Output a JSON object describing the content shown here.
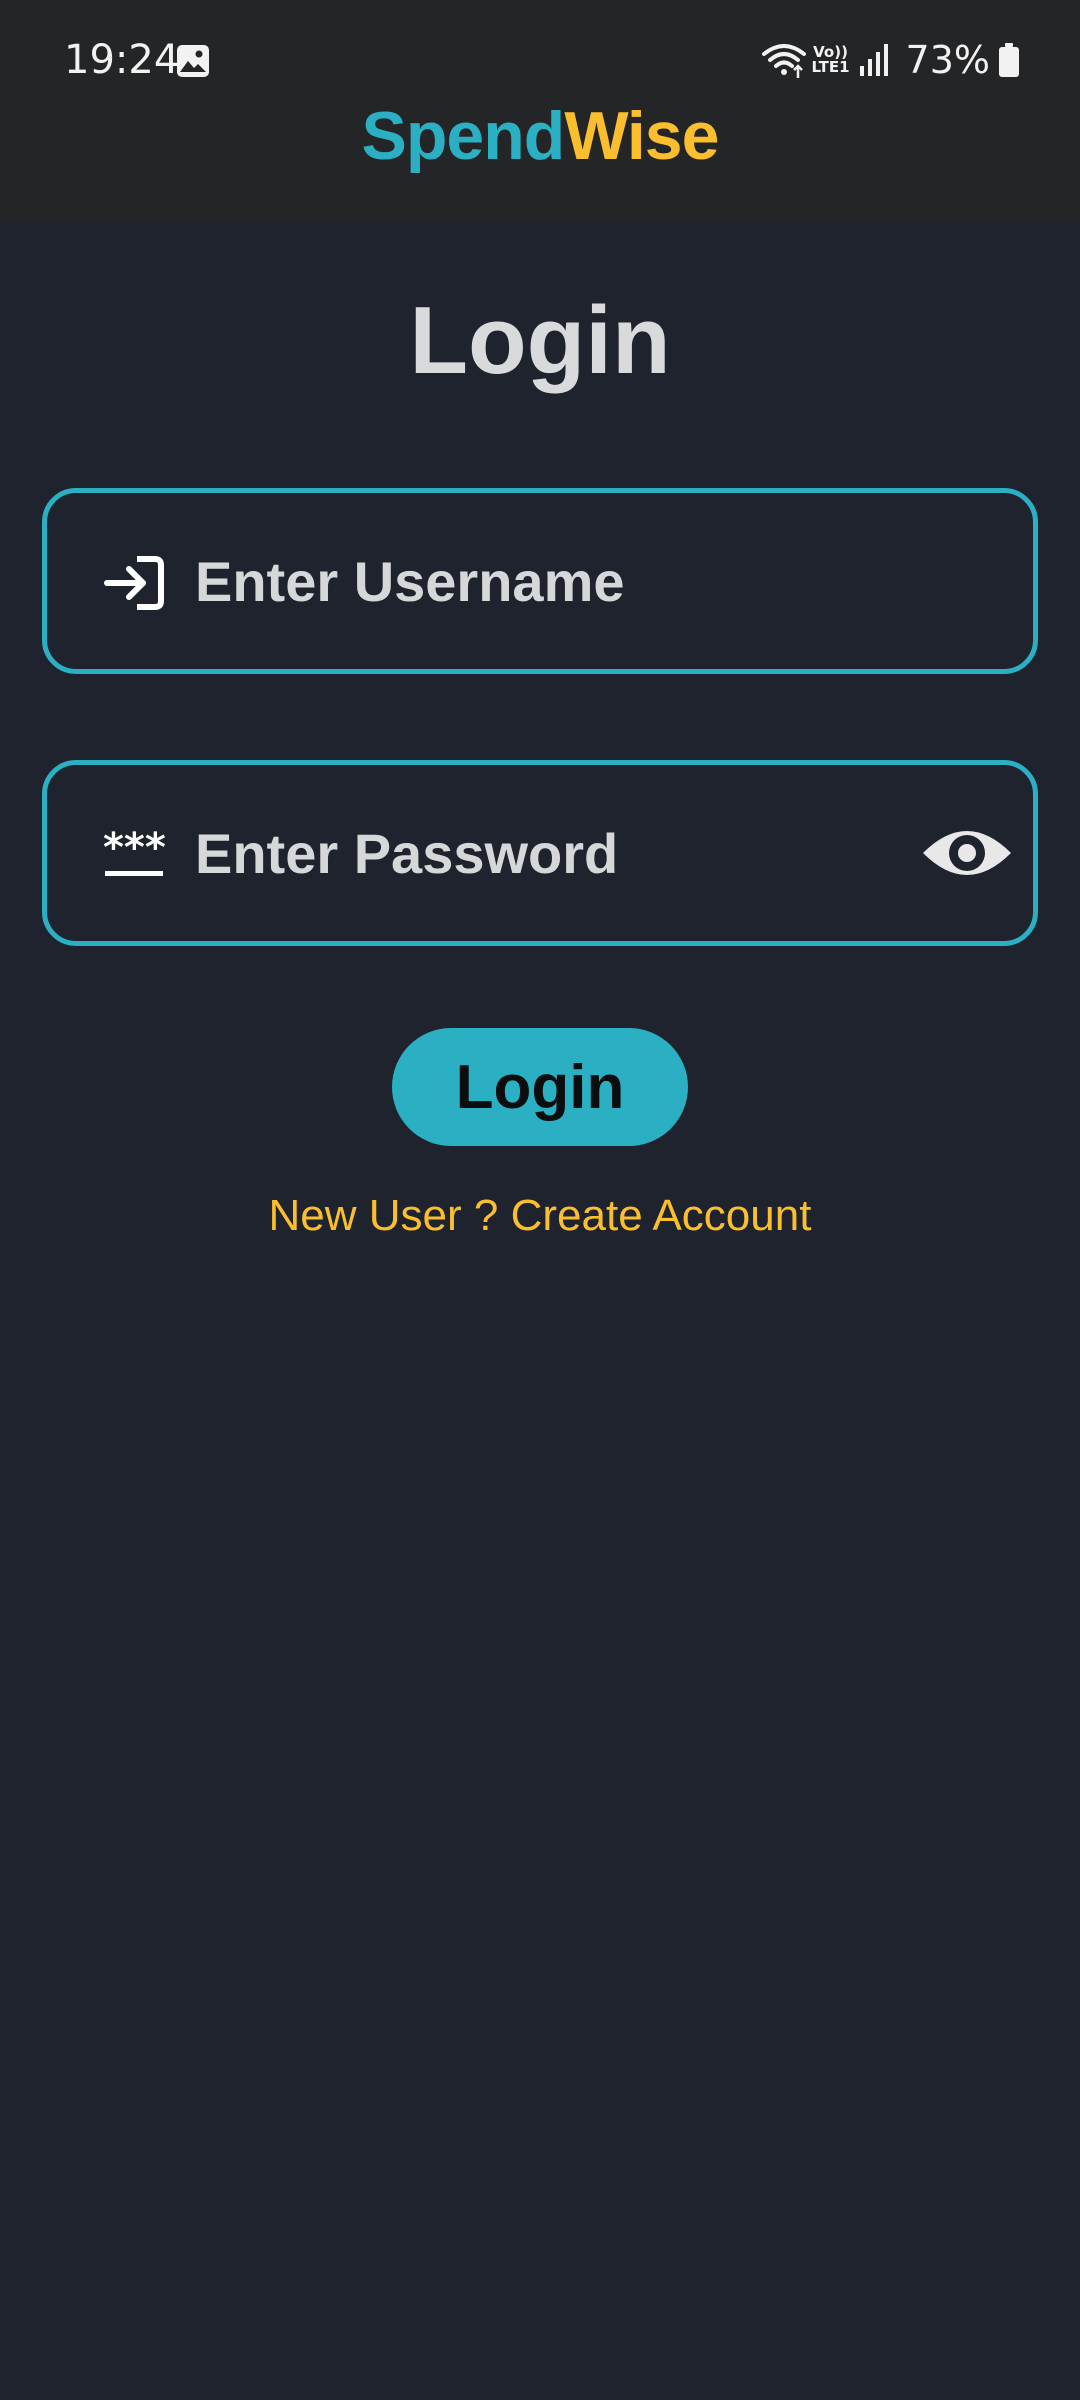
{
  "status_bar": {
    "time": "19:24",
    "network_label_top": "Vo))",
    "network_label_bottom": "LTE1",
    "battery": "73%",
    "icons": [
      "gallery-icon",
      "wifi-icon",
      "signal-icon",
      "battery-icon"
    ]
  },
  "header": {
    "brand_part1": "Spend",
    "brand_part2": "Wise",
    "brand_color_1": "#2ab0c2",
    "brand_color_2": "#fbbf2d"
  },
  "page": {
    "title": "Login"
  },
  "form": {
    "username_placeholder": "Enter Username",
    "username_value": "",
    "username_icon": "login-arrow-icon",
    "password_placeholder": "Enter Password",
    "password_value": "",
    "password_icon": "password-icon",
    "visibility_icon": "eye-icon",
    "submit_label": "Login",
    "create_account_link": "New User ? Create Account"
  },
  "colors": {
    "background": "#1e232d",
    "header": "#242526",
    "accent": "#2ab0c2",
    "link": "#fbbf2d",
    "text": "#d9dadb"
  }
}
